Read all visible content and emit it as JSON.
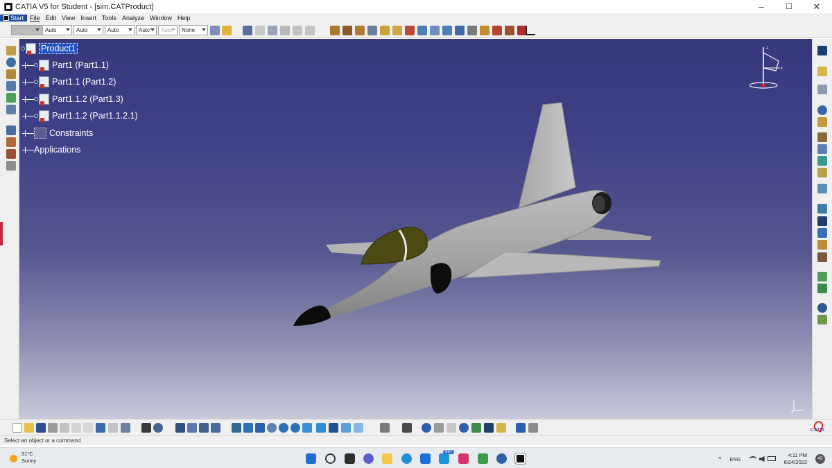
{
  "window": {
    "title": "CATIA V5 for Student - [sim.CATProduct]",
    "minimize_glyph": "–",
    "maximize_glyph": "☐",
    "close_glyph": "✕"
  },
  "menu": {
    "items": [
      "Start",
      "File",
      "Edit",
      "View",
      "Insert",
      "Tools",
      "Analyze",
      "Window",
      "Help"
    ]
  },
  "toolbar_top": {
    "combos": [
      "",
      "Auto",
      "Auto",
      "Auto",
      "Autc",
      "Autc",
      "None"
    ]
  },
  "spec_tree": {
    "root": "Product1",
    "children": [
      "Part1 (Part1.1)",
      "Part1.1 (Part1.2)",
      "Part1.1.2 (Part1.3)",
      "Part1.1.2 (Part1.1.2.1)",
      "Constraints",
      "Applications"
    ]
  },
  "compass": {
    "z_label": "z",
    "x_label": "x"
  },
  "status_bar": {
    "message": "Select an object or a command"
  },
  "bottom_toolbar": {
    "logo_text": "CATIA"
  },
  "taskbar": {
    "weather_temp": "31°C",
    "weather_desc": "Sunny",
    "badge": "99+",
    "language": "ENG",
    "time": "4:11 PM",
    "date": "6/24/2022",
    "notifications": "45"
  },
  "colors": {
    "start_menu_bg": "#1e4f9e",
    "selection_bg": "#2050c0",
    "fuselage": "#a9a9a9",
    "canopy": "#4a4a12",
    "viewport_top": "#37377c"
  }
}
